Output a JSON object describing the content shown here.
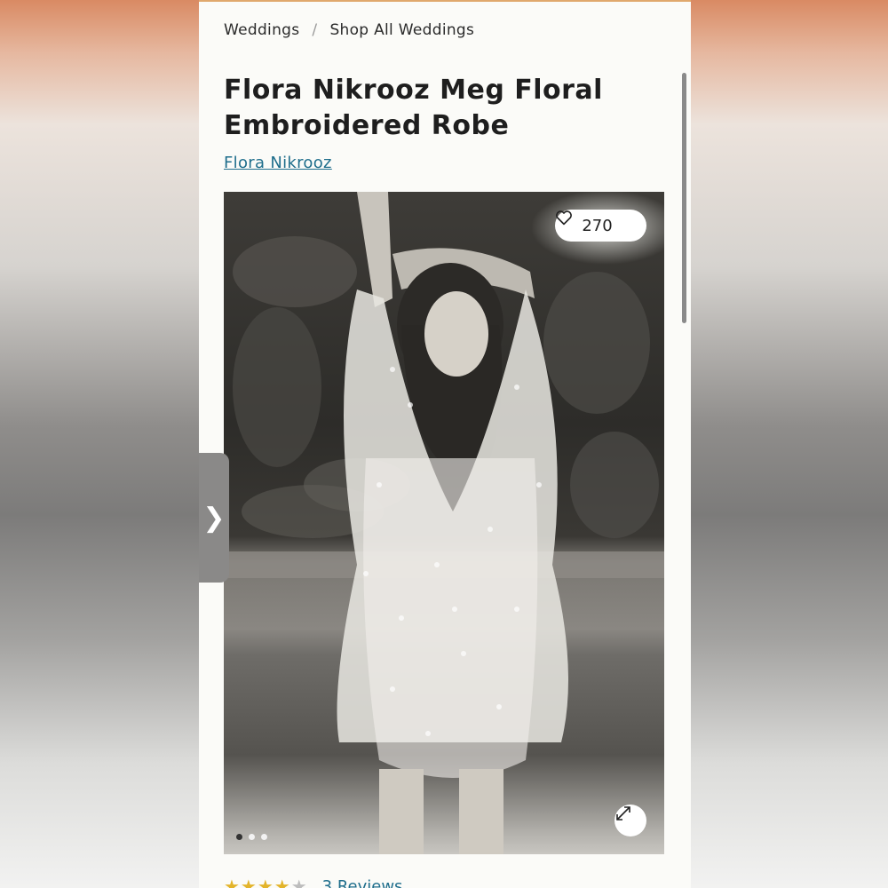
{
  "breadcrumb": {
    "items": [
      "Weddings",
      "Shop All Weddings"
    ],
    "separator": "/"
  },
  "product": {
    "title": "Flora Nikrooz Meg Floral Embroidered Robe",
    "brand": "Flora Nikrooz"
  },
  "gallery": {
    "likes_count": "270",
    "heart_icon": "heart-outline-icon",
    "expand_icon": "expand-arrows-icon",
    "dots_total": 3,
    "dots_active_index": 0,
    "next_arrow": "❯"
  },
  "reviews": {
    "rating_out_of_5": 4,
    "label": "3 Reviews"
  },
  "colors": {
    "link": "#1f6e8c",
    "star": "#e3b42b",
    "accent_top": "#e0a86d"
  }
}
